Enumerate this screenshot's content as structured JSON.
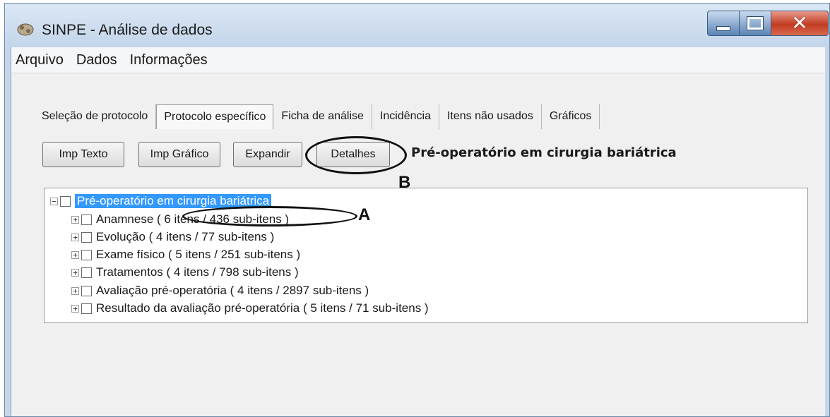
{
  "window": {
    "title": "SINPE - Análise de dados",
    "icon": "app-icon",
    "controls": {
      "minimize": "minimize-icon",
      "maximize": "maximize-icon",
      "close": "✕"
    }
  },
  "menu": [
    "Arquivo",
    "Dados",
    "Informações"
  ],
  "tabs": [
    {
      "label": "Seleção de protocolo",
      "active": false
    },
    {
      "label": "Protocolo específico",
      "active": true
    },
    {
      "label": "Ficha de análise",
      "active": false
    },
    {
      "label": "Incidência",
      "active": false
    },
    {
      "label": "Itens não usados",
      "active": false
    },
    {
      "label": "Gráficos",
      "active": false
    }
  ],
  "toolbar": {
    "imp_texto": "Imp Texto",
    "imp_grafico": "Imp Gráfico",
    "expandir": "Expandir",
    "detalhes": "Detalhes",
    "protocol_label": "Pré-operatório em cirurgia bariátrica"
  },
  "tree": {
    "root": "Pré-operatório em cirurgia bariátrica",
    "children": [
      "Anamnese ( 6 itens / 436 sub-itens )",
      "Evolução ( 4 itens / 77 sub-itens )",
      "Exame físico ( 5 itens / 251 sub-itens )",
      "Tratamentos ( 4 itens / 798 sub-itens )",
      "Avaliação pré-operatória ( 4 itens / 2897 sub-itens )",
      "Resultado da avaliação pré-operatória ( 5 itens / 71 sub-itens )"
    ]
  },
  "annotations": {
    "a": "A",
    "b": "B"
  },
  "colors": {
    "selection": "#3399ff",
    "title_bar": "#c5d6ea",
    "close_button": "#c23c22"
  }
}
